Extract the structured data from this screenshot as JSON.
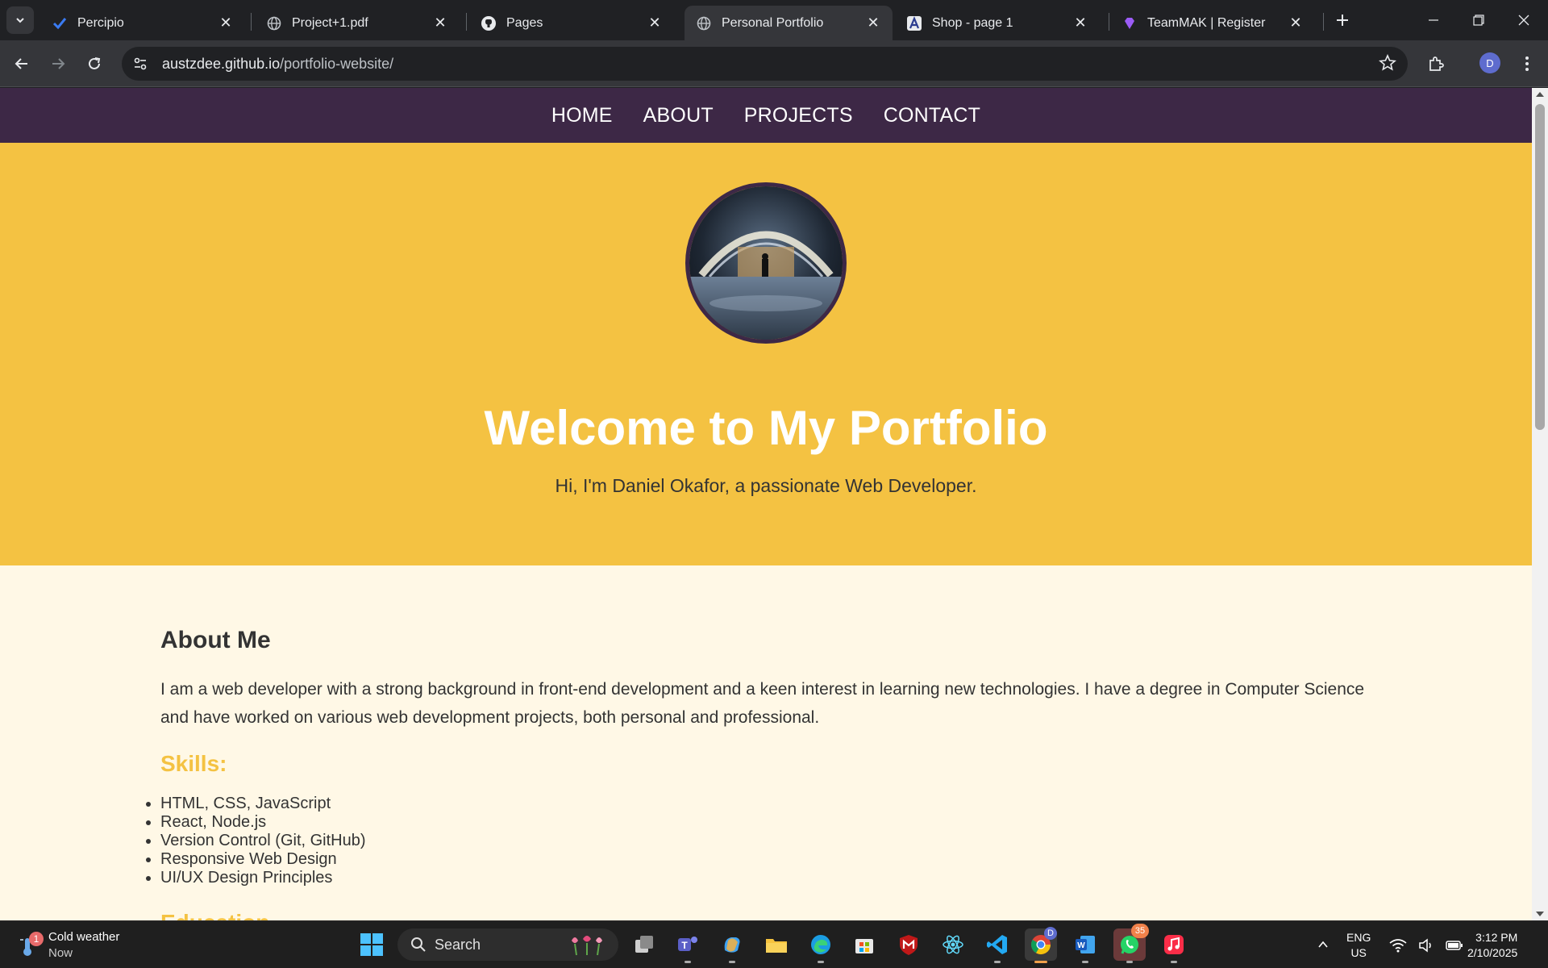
{
  "browser": {
    "tabs": [
      {
        "title": "Percipio",
        "icon": "percipio-icon",
        "active": false
      },
      {
        "title": "Project+1.pdf",
        "icon": "globe-icon",
        "active": false
      },
      {
        "title": "Pages",
        "icon": "github-icon",
        "active": false
      },
      {
        "title": "Personal Portfolio",
        "icon": "globe-icon",
        "active": true
      },
      {
        "title": "Shop - page 1",
        "icon": "a-letter-icon",
        "active": false
      },
      {
        "title": "TeamMAK | Register",
        "icon": "diamond-icon",
        "active": false
      }
    ],
    "url_host": "austzdee.github.io",
    "url_path": "/portfolio-website/",
    "profile_initial": "D"
  },
  "site": {
    "nav": [
      "HOME",
      "ABOUT",
      "PROJECTS",
      "CONTACT"
    ],
    "hero": {
      "title": "Welcome to My Portfolio",
      "subtitle": "Hi, I'm Daniel Okafor, a passionate Web Developer."
    },
    "about": {
      "heading": "About Me",
      "bio": "I am a web developer with a strong background in front-end development and a keen interest in learning new technologies. I have a degree in Computer Science and have worked on various web development projects, both personal and professional.",
      "skills_heading": "Skills:",
      "skills": [
        "HTML, CSS, JavaScript",
        "React, Node.js",
        "Version Control (Git, GitHub)",
        "Responsive Web Design",
        "UI/UX Design Principles"
      ],
      "next_heading": "Education"
    },
    "colors": {
      "nav": "#3d2846",
      "hero": "#f4c242",
      "page": "#fff8e6"
    }
  },
  "taskbar": {
    "weather_title": "Cold weather",
    "weather_sub": "Now",
    "weather_badge": "1",
    "search_placeholder": "Search",
    "chrome_badge": "D",
    "whatsapp_badge": "35",
    "lang_line1": "ENG",
    "lang_line2": "US",
    "time": "3:12 PM",
    "date": "2/10/2025"
  }
}
